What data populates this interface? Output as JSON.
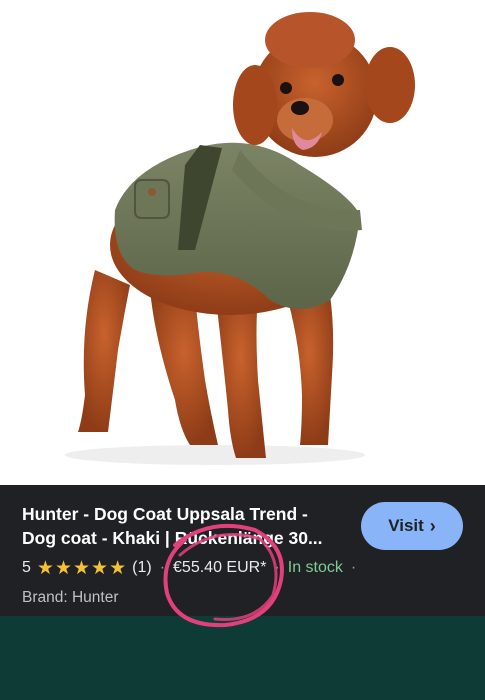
{
  "product": {
    "title_line1": "Hunter - Dog Coat Uppsala Trend -",
    "title_line2": "Dog coat - Khaki | Rückenlänge 30...",
    "rating_value": "5",
    "stars": [
      "★",
      "★",
      "★",
      "★",
      "★"
    ],
    "review_count": "(1)",
    "separator": "·",
    "price": "€55.40 EUR*",
    "stock_status": "In stock",
    "brand": "Brand: Hunter"
  },
  "visit_button": {
    "label": "Visit",
    "icon": "chevron-right-icon",
    "glyph": "›"
  },
  "colors": {
    "panel_bg": "#1f2124",
    "button_bg": "#8ab4f8",
    "star": "#f4c034",
    "stock": "#81c995",
    "annotation": "#e2407a",
    "bottom_band": "#0e3b36"
  }
}
